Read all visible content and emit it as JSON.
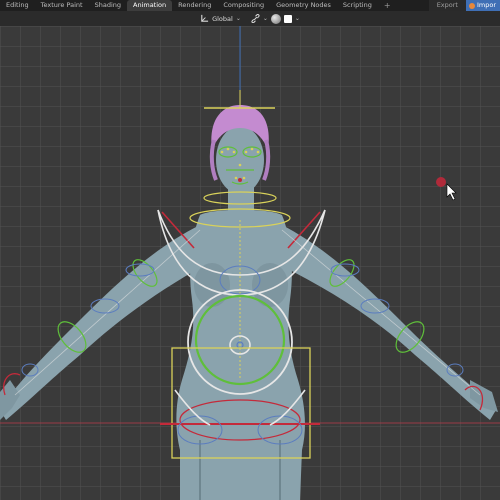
{
  "workspace_tabs": [
    {
      "label": "Editing",
      "active": false
    },
    {
      "label": "Texture Paint",
      "active": false
    },
    {
      "label": "Shading",
      "active": false
    },
    {
      "label": "Animation",
      "active": true
    },
    {
      "label": "Rendering",
      "active": false
    },
    {
      "label": "Compositing",
      "active": false
    },
    {
      "label": "Geometry Nodes",
      "active": false
    },
    {
      "label": "Scripting",
      "active": false
    }
  ],
  "add_tab_symbol": "+",
  "top_right": {
    "export_label": "Export",
    "import_label": "Impor"
  },
  "header": {
    "orientation_label": "Global",
    "orientation_icon": "transform-orientation-icon",
    "snap_icon": "snap-link-icon",
    "shading_icon": "sphere-icon",
    "caret": "⌄"
  },
  "colors": {
    "accent": "#3f6fb5",
    "bone_outline": "#e6e6e6",
    "control_green": "#5fbf3a",
    "control_yellow": "#d9d25a",
    "control_red": "#c42a3a",
    "axis_red": "#d23c4c",
    "axis_blue": "#3a73c8",
    "mesh_body": "#8aa3ad",
    "hair": "#c48bd0"
  }
}
